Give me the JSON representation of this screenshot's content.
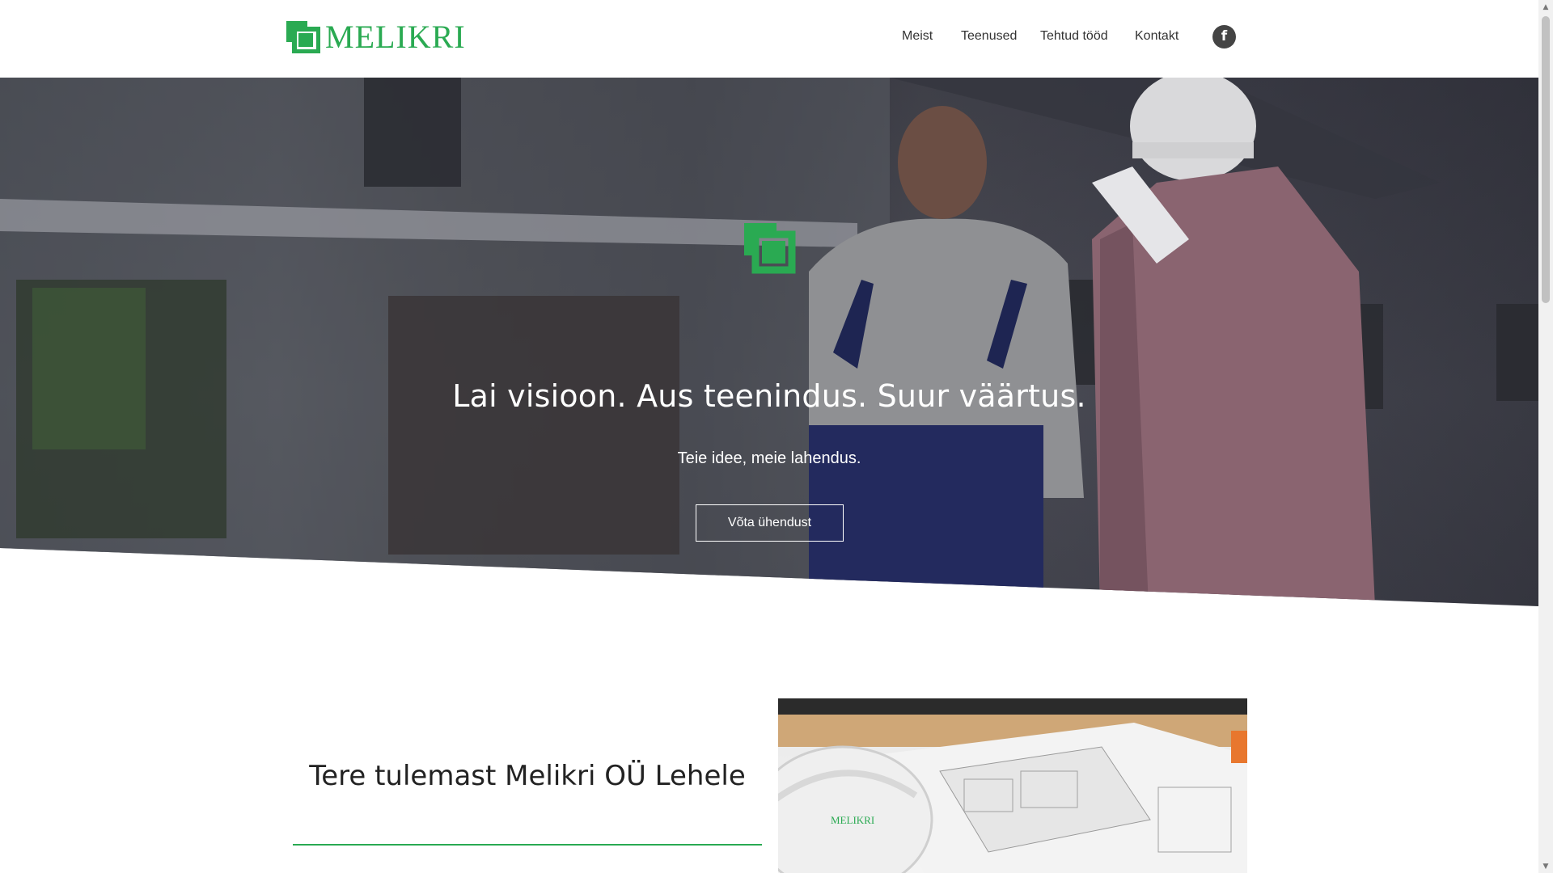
{
  "brand": {
    "logo_text": "MELIKRI",
    "accent_color": "#2aaa52"
  },
  "nav": {
    "items": [
      {
        "label": "Meist"
      },
      {
        "label": "Teenused"
      },
      {
        "label": "Tehtud tööd"
      },
      {
        "label": "Kontakt"
      }
    ],
    "social": {
      "icon": "facebook-icon",
      "glyph": "f"
    }
  },
  "hero": {
    "title": "Lai visioon. Aus teenindus. Suur väärtus.",
    "subtitle": "Teie idee, meie lahendus.",
    "cta_label": "Võta ühendust",
    "icon": "melikri-mark-icon"
  },
  "welcome": {
    "title": "Tere tulemast Melikri OÜ Lehele",
    "photo_stamp": "MELIKRI"
  },
  "scrollbar": {
    "up_glyph": "▲",
    "down_glyph": "▼"
  }
}
